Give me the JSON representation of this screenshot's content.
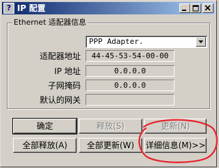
{
  "window": {
    "title": "IP 配置",
    "icon": "question-mark-icon"
  },
  "group": {
    "legend": "Ethernet 适配器信息"
  },
  "adapter_select": {
    "value": "PPP Adapter."
  },
  "fields": [
    {
      "label": "适配器地址",
      "value": "44-45-53-54-00-00"
    },
    {
      "label": "IP 地址",
      "value": "0.0.0.0"
    },
    {
      "label": "子网掩码",
      "value": "0.0.0.0"
    },
    {
      "label": "默认的网关",
      "value": ""
    }
  ],
  "buttons": {
    "ok": "确定",
    "release": "释放(S)",
    "renew": "更新(N)",
    "release_all": "全部释放(A)",
    "renew_all": "全部更新(W)",
    "more_info": "详细信息(M)>>"
  },
  "annotation": {
    "color": "#e8202a"
  }
}
